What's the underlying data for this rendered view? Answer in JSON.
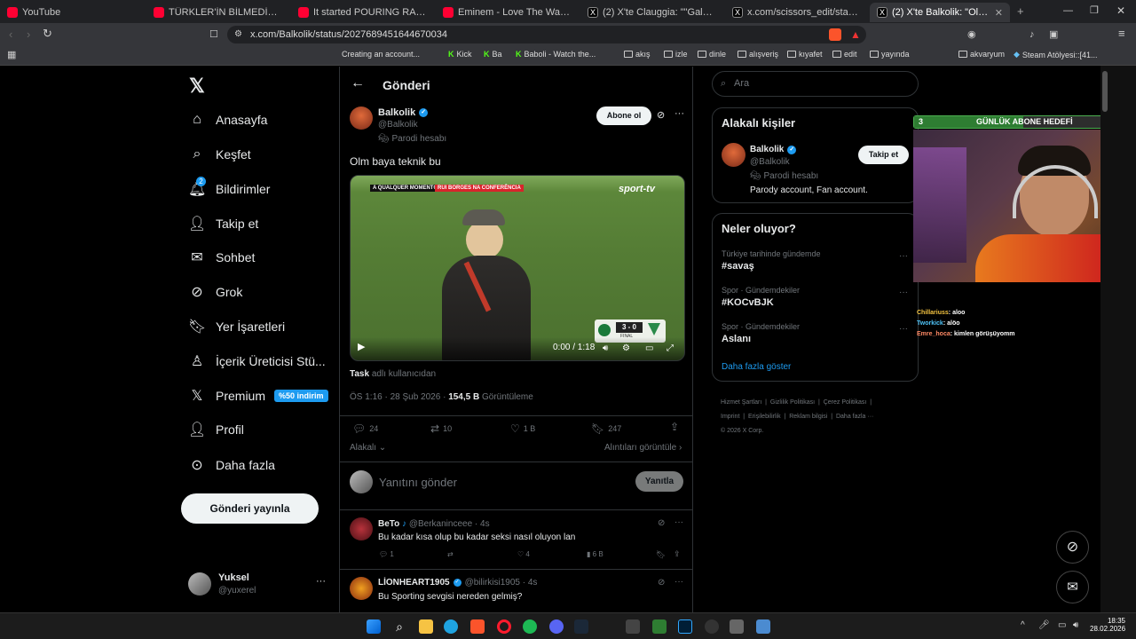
{
  "browser": {
    "tabs": [
      {
        "title": "YouTube",
        "icon": "youtube-icon"
      },
      {
        "title": "TÜRKLER'İN BİLMEDİĞİ UCUZA TATİL",
        "icon": "youtube-icon"
      },
      {
        "title": "It started POURING RAIN! There were",
        "icon": "youtube-icon"
      },
      {
        "title": "Eminem - Love The Way You Lie ft. Ri",
        "icon": "youtube-icon"
      },
      {
        "title": "(2) X'te Clauggia: \"\"Galatasaray herke",
        "icon": "x-icon"
      },
      {
        "title": "x.com/scissors_edit/status/20274775",
        "icon": "x-icon"
      },
      {
        "title": "(2) X'te Balkolik: \"Olm baya tekni",
        "icon": "x-icon"
      }
    ],
    "url": "x.com/Balkolik/status/2027689451644670034",
    "bookmarks": [
      "Kick",
      "Ba",
      "Creating an account...",
      "Baboli - Watch the...",
      "akış",
      "izle",
      "dinle",
      "alışveriş",
      "kıyafet",
      "edit",
      "yayında",
      "akvaryum",
      "Steam Atölyesi::[41..."
    ]
  },
  "nav": {
    "items": [
      {
        "label": "Anasayfa",
        "icon": "home-icon"
      },
      {
        "label": "Keşfet",
        "icon": "search-icon"
      },
      {
        "label": "Bildirimler",
        "icon": "bell-icon",
        "badge": "2"
      },
      {
        "label": "Takip et",
        "icon": "follow-icon"
      },
      {
        "label": "Sohbet",
        "icon": "mail-icon"
      },
      {
        "label": "Grok",
        "icon": "grok-icon"
      },
      {
        "label": "Yer İşaretleri",
        "icon": "bookmark-icon"
      },
      {
        "label": "İçerik Üreticisi Stü...",
        "icon": "creator-icon"
      },
      {
        "label": "Premium",
        "icon": "x-logo-icon",
        "badge": "%50 indirim"
      },
      {
        "label": "Profil",
        "icon": "person-icon"
      },
      {
        "label": "Daha fazla",
        "icon": "more-circle-icon"
      }
    ],
    "post_button": "Gönderi yayınla",
    "account": {
      "name": "Yuksel",
      "handle": "@yuxerel"
    }
  },
  "post": {
    "header_title": "Gönderi",
    "author": {
      "name": "Balkolik",
      "handle": "@Balkolik",
      "parody": "Parodi hesabı"
    },
    "subscribe_button": "Abone ol",
    "text": "Olm baya teknik bu",
    "video": {
      "caption_left": "A QUALQUER MOMENTO",
      "caption_red": "RUI BORGES NA CONFERÊNCIA",
      "channel": "sport-tv",
      "score": "3 - 0",
      "score_label": "FINAL",
      "time": "0:00 / 1:18"
    },
    "tagged_bold": "Task",
    "tagged_rest": "adlı kullanıcıdan",
    "time": "ÖS 1:16 · 28 Şub 2026 ·",
    "views": "154,5 B",
    "views_label": "Görüntüleme",
    "stats": {
      "replies": "24",
      "reposts": "10",
      "likes": "1 B",
      "bookmarks": "247"
    },
    "relevant": "Alakalı",
    "quotes": "Alıntıları görüntüle",
    "reply_placeholder": "Yanıtını gönder",
    "reply_button": "Yanıtla"
  },
  "replies": [
    {
      "name": "BeTo",
      "handle": "@Berkaninceee · 4s",
      "text": "Bu kadar kısa olup bu kadar seksi nasıl oluyon lan",
      "stats": {
        "replies": "1",
        "likes": "4",
        "views": "6 B"
      }
    },
    {
      "name": "LİONHEART1905",
      "handle": "@bilirkisi1905 · 4s",
      "text": "Bu Sporting sevgisi nereden gelmiş?"
    }
  ],
  "right": {
    "search_placeholder": "Ara",
    "relevant_title": "Alakalı kişiler",
    "person": {
      "name": "Balkolik",
      "handle": "@Balkolik",
      "parody": "Parodi hesabı",
      "bio": "Parody account, Fan account.",
      "button": "Takip et"
    },
    "trends_title": "Neler oluyor?",
    "trends": [
      {
        "meta": "Türkiye tarihinde gündemde",
        "name": "#savaş"
      },
      {
        "meta": "Spor · Gündemdekiler",
        "name": "#KOCvBJK"
      },
      {
        "meta": "Spor · Gündemdekiler",
        "name": "Aslanı"
      }
    ],
    "show_more": "Daha fazla göster",
    "footer": [
      "Hizmet Şartları",
      "Gizlilik Politikası",
      "Çerez Politikası",
      "Imprint",
      "Erişilebilirlik",
      "Reklam bilgisi",
      "Daha fazla ···",
      "© 2026 X Corp."
    ]
  },
  "stream": {
    "goal_left": "3",
    "goal_label": "GÜNLÜK ABONE HEDEFİ",
    "goal_right": "6",
    "goal_fraction": 0.5,
    "chat": [
      {
        "user": "Chillariuss",
        "text": ": aloo",
        "color": "#f5c542"
      },
      {
        "user": "Tworkick",
        "text": ": alöo",
        "color": "#4fc3f7"
      },
      {
        "user": "Emre_hoca",
        "text": ": kimlen görüşüyomm",
        "color": "#ff8a65"
      }
    ]
  },
  "taskbar": {
    "time": "18:35",
    "date": "28.02.2026"
  }
}
